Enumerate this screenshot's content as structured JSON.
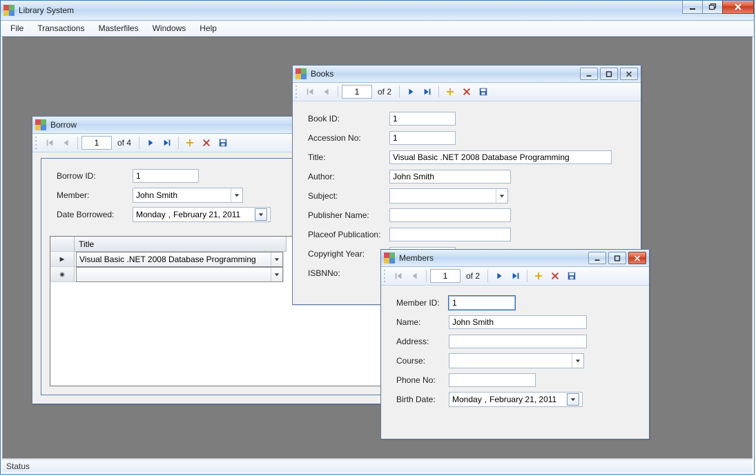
{
  "app": {
    "title": "Library System",
    "menus": [
      "File",
      "Transactions",
      "Masterfiles",
      "Windows",
      "Help"
    ],
    "status": "Status"
  },
  "borrow": {
    "title": "Borrow",
    "nav_pos": "1",
    "nav_of": "of 4",
    "fields": {
      "borrow_id_label": "Borrow ID:",
      "borrow_id": "1",
      "member_label": "Member:",
      "member": "John Smith",
      "date_label": "Date Borrowed:",
      "date_weekday": "Monday",
      "date_sep": ",",
      "date_rest": "February  21, 2011"
    },
    "grid": {
      "column_title": "Title",
      "row1_value": "Visual Basic .NET 2008 Database Programming"
    }
  },
  "books": {
    "title": "Books",
    "nav_pos": "1",
    "nav_of": "of 2",
    "fields": {
      "book_id_label": "Book ID:",
      "book_id": "1",
      "accession_label": "Accession No:",
      "accession": "1",
      "title_label": "Title:",
      "title_value": "Visual Basic .NET 2008 Database Programming",
      "author_label": "Author:",
      "author": "John Smith",
      "subject_label": "Subject:",
      "subject": "",
      "publisher_label": "Publisher Name:",
      "publisher": "",
      "place_label": "Placeof Publication:",
      "place": "",
      "copyright_label": "Copyright Year:",
      "copyright": "",
      "isbn_label": "ISBNNo:",
      "isbn": ""
    }
  },
  "members": {
    "title": "Members",
    "nav_pos": "1",
    "nav_of": "of 2",
    "fields": {
      "member_id_label": "Member ID:",
      "member_id": "1",
      "name_label": "Name:",
      "name": "John Smith",
      "address_label": "Address:",
      "address": "",
      "course_label": "Course:",
      "course": "",
      "phone_label": "Phone No:",
      "phone": "",
      "birth_label": "Birth Date:",
      "birth_weekday": "Monday",
      "birth_sep": ",",
      "birth_rest": "February  21, 2011"
    }
  }
}
